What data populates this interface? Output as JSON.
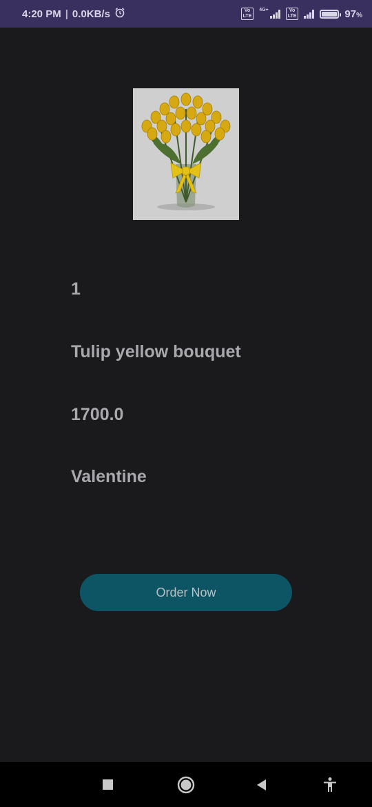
{
  "status_bar": {
    "time": "4:20 PM",
    "separator": "|",
    "speed": "0.0KB/s",
    "alarm_icon": "alarm-clock-icon",
    "volte_badge_1": "Vo\nLTE",
    "network_type": "4G+",
    "volte_badge_2": "Vo\nLTE",
    "battery_percent": "97",
    "battery_suffix": "%",
    "battery_level": 0.97
  },
  "product": {
    "image_icon": "tulip-bouquet-image",
    "id": "1",
    "name": "Tulip yellow bouquet",
    "price": "1700.0",
    "category": "Valentine"
  },
  "actions": {
    "order_label": "Order Now"
  },
  "nav_bar": {
    "recents_icon": "square-icon",
    "home_icon": "circle-home-icon",
    "back_icon": "triangle-back-icon",
    "accessibility_icon": "accessibility-icon"
  },
  "colors": {
    "background": "#1a191b",
    "status_bar": "#3a3060",
    "button": "#0d5565",
    "text": "#a9a8ad"
  }
}
